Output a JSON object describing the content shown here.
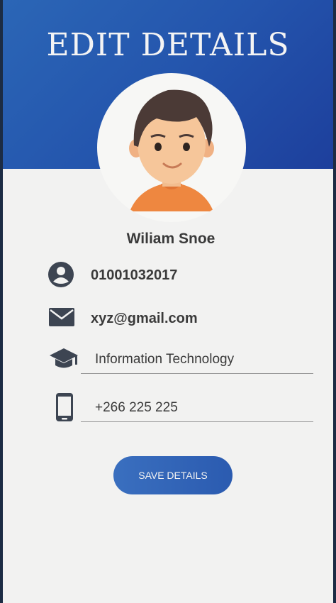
{
  "header": {
    "title": "EDIT DETAILS"
  },
  "profile": {
    "name": "Wiliam Snoe",
    "phone_id": "01001032017",
    "email": "xyz@gmail.com",
    "department": "Information Technology",
    "mobile": "+266 225 225"
  },
  "icons": {
    "account": "account-circle-icon",
    "email": "mail-icon",
    "department": "graduation-cap-icon",
    "mobile": "smartphone-icon"
  },
  "actions": {
    "save_label": "SAVE DETAILS"
  },
  "colors": {
    "header_blue": "#2455ad",
    "button_blue": "#3265b8",
    "icon_dark": "#3d4552",
    "text_dark": "#3a3a3a",
    "background": "#f2f2f1"
  }
}
